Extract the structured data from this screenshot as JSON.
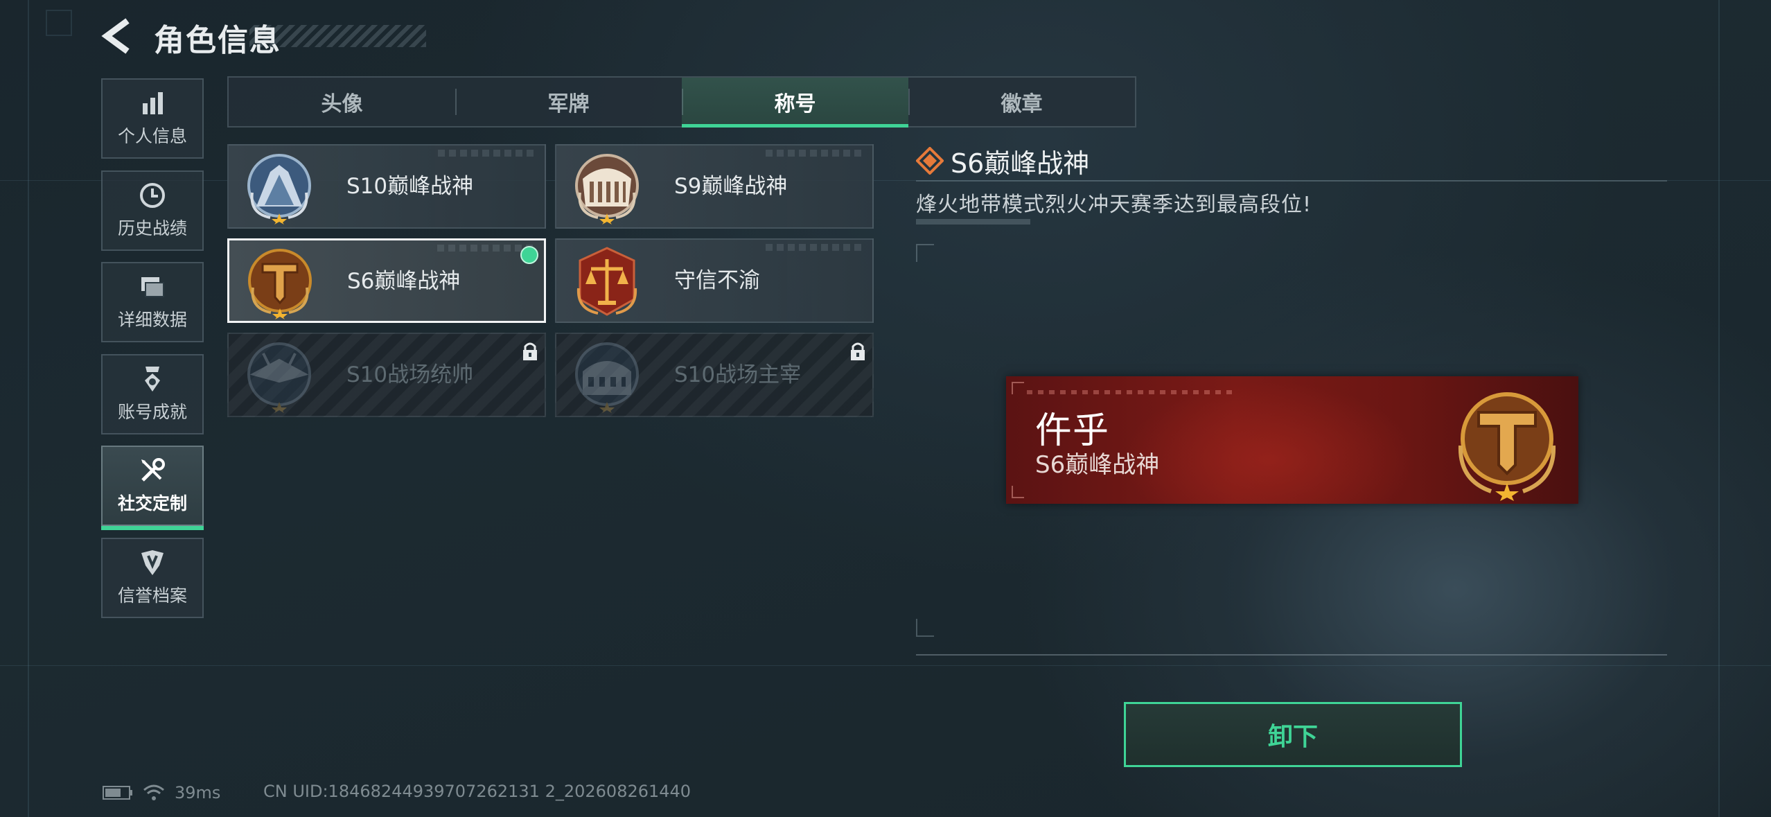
{
  "header": {
    "title": "角色信息",
    "back_icon": "chevron-left-icon"
  },
  "sidebar": {
    "items": [
      {
        "label": "个人信息",
        "icon": "bar-chart-icon",
        "active": false
      },
      {
        "label": "历史战绩",
        "icon": "clock-icon",
        "active": false
      },
      {
        "label": "详细数据",
        "icon": "folders-icon",
        "active": false
      },
      {
        "label": "账号成就",
        "icon": "medal-icon",
        "active": false
      },
      {
        "label": "社交定制",
        "icon": "tools-icon",
        "active": true
      },
      {
        "label": "信誉档案",
        "icon": "emblem-icon",
        "active": false
      }
    ]
  },
  "tabs": [
    {
      "label": "头像",
      "active": false
    },
    {
      "label": "军牌",
      "active": false
    },
    {
      "label": "称号",
      "active": true
    },
    {
      "label": "徽章",
      "active": false
    }
  ],
  "titles": [
    {
      "name": "S10巅峰战神",
      "state": "normal"
    },
    {
      "name": "S9巅峰战神",
      "state": "normal"
    },
    {
      "name": "S6巅峰战神",
      "state": "selected-equipped"
    },
    {
      "name": "守信不渝",
      "state": "normal"
    },
    {
      "name": "S10战场统帅",
      "state": "locked"
    },
    {
      "name": "S10战场主宰",
      "state": "locked"
    }
  ],
  "detail": {
    "title": "S6巅峰战神",
    "description": "烽火地带模式烈火冲天赛季达到最高段位!"
  },
  "banner": {
    "player_name": "仵乎",
    "title": "S6巅峰战神"
  },
  "actions": {
    "unequip_label": "卸下"
  },
  "status": {
    "ping": "39ms",
    "uid": "CN UID:18468244939707262131 2_202608261440"
  },
  "colors": {
    "accent": "#3fd496",
    "banner_red": "#7a1a16",
    "gold": "#c98a2b"
  }
}
